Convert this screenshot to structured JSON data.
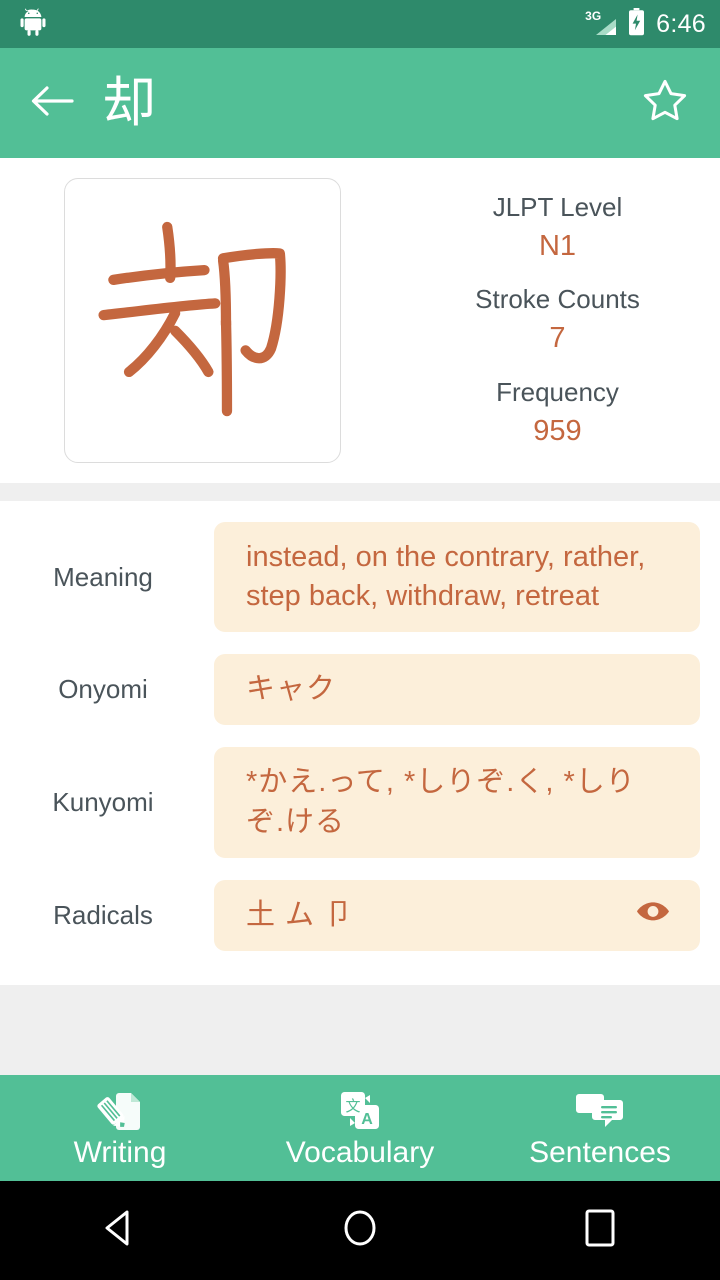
{
  "status_bar": {
    "network_label": "3G",
    "battery_icon": "battery-charging-icon",
    "signal_icon": "signal-3g-icon",
    "android_icon": "android-robot-icon",
    "time": "6:46"
  },
  "app_bar": {
    "back_icon": "arrow-back-icon",
    "title": "却",
    "favorite_icon": "star-outline-icon"
  },
  "kanji_card": {
    "character": "却",
    "stroke_color": "#c4673f"
  },
  "stats": [
    {
      "label": "JLPT Level",
      "value": "N1"
    },
    {
      "label": "Stroke Counts",
      "value": "7"
    },
    {
      "label": "Frequency",
      "value": "959"
    }
  ],
  "details": [
    {
      "label": "Meaning",
      "value": "instead, on the contrary, rather, step back, withdraw, retreat",
      "icon": null
    },
    {
      "label": "Onyomi",
      "value": "キャク",
      "icon": null
    },
    {
      "label": "Kunyomi",
      "value": "*かえ.って, *しりぞ.く, *しりぞ.ける",
      "icon": null
    },
    {
      "label": "Radicals",
      "value": "土 ム 卩",
      "icon": "eye-visibility-icon"
    }
  ],
  "tabs": [
    {
      "label": "Writing",
      "icon": "pencil-document-icon"
    },
    {
      "label": "Vocabulary",
      "icon": "translate-icon"
    },
    {
      "label": "Sentences",
      "icon": "chat-bubbles-icon"
    }
  ],
  "nav_bar": {
    "back_icon": "nav-back-triangle-icon",
    "home_icon": "nav-home-circle-icon",
    "recents_icon": "nav-recents-square-icon"
  },
  "colors": {
    "status_bar": "#2e8a6b",
    "app_bar": "#52bf96",
    "accent": "#c4673f",
    "value_box": "#fcefda",
    "label_text": "#4a545a",
    "separator": "#efefef"
  }
}
